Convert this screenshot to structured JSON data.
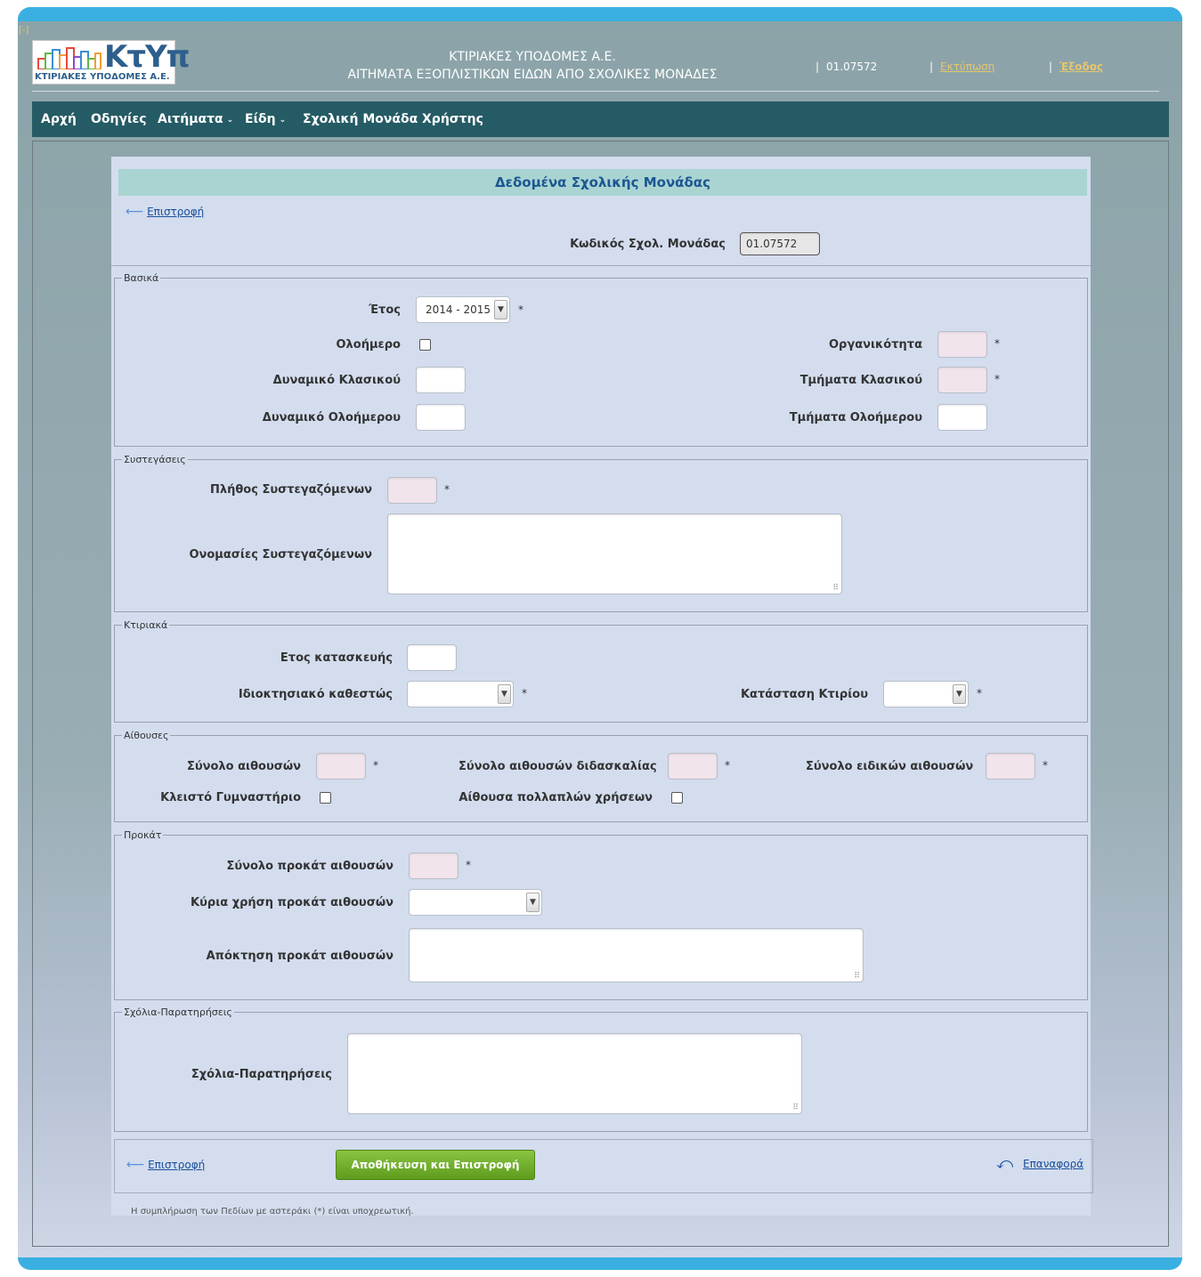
{
  "header": {
    "collapse": "[-]",
    "logo_text": "ΚτΥπ",
    "logo_sub": "ΚΤΙΡΙΑΚΕΣ ΥΠΟΔΟΜΕΣ Α.Ε.",
    "title_line1": "ΚΤΙΡΙΑΚΕΣ ΥΠΟΔΟΜΕΣ Α.Ε.",
    "title_line2": "ΑΙΤΗΜΑΤΑ ΕΞΟΠΛΙΣΤΙΚΩΝ ΕΙΔΩΝ ΑΠΟ ΣΧΟΛΙΚΕΣ ΜΟΝΑΔΕΣ",
    "sep": "|",
    "school_code": "01.07572",
    "print_label": "Εκτύπωση",
    "logout_label": "Έξοδος"
  },
  "nav": {
    "items": [
      "Αρχή",
      "Οδηγίες",
      "Αιτήματα",
      "Είδη",
      "Σχολική Μονάδα",
      "Χρήστης"
    ],
    "dropdown_caret": "⌄"
  },
  "panel": {
    "title": "Δεδομένα Σχολικής Μονάδας",
    "back_label": "Επιστροφή",
    "code_label": "Κωδικός Σχολ. Μονάδας",
    "code_value": "01.07572"
  },
  "basic": {
    "legend": "Βασικά",
    "year_label": "Έτος",
    "year_value": "2014 - 2015",
    "allday_label": "Ολοήμερο",
    "organic_label": "Οργανικότητα",
    "dyn_classic_label": "Δυναμικό Κλασικού",
    "sections_classic_label": "Τμήματα Κλασικού",
    "dyn_allday_label": "Δυναμικό Ολοήμερου",
    "sections_allday_label": "Τμήματα Ολοήμερου"
  },
  "cohoused": {
    "legend": "Συστεγάσεις",
    "count_label": "Πλήθος Συστεγαζόμενων",
    "names_label": "Ονομασίες Συστεγαζόμενων"
  },
  "building": {
    "legend": "Κτιριακά",
    "year_built_label": "Ετος κατασκευής",
    "ownership_label": "Ιδιοκτησιακό καθεστώς",
    "condition_label": "Κατάσταση Κτιρίου"
  },
  "rooms": {
    "legend": "Αίθουσες",
    "total_label": "Σύνολο αιθουσών",
    "teaching_label": "Σύνολο αιθουσών διδασκαλίας",
    "special_label": "Σύνολο ειδικών αιθουσών",
    "gym_label": "Κλειστό Γυμναστήριο",
    "multi_label": "Αίθουσα πολλαπλών χρήσεων"
  },
  "prefab": {
    "legend": "Προκάτ",
    "total_label": "Σύνολο προκάτ αιθουσών",
    "use_label": "Κύρια χρήση προκάτ αιθουσών",
    "acquire_label": "Απόκτηση προκάτ αιθουσών"
  },
  "comments": {
    "legend": "Σχόλια-Παρατηρήσεις",
    "label": "Σχόλια-Παρατηρήσεις"
  },
  "footer": {
    "back_label": "Επιστροφή",
    "save_label": "Αποθήκευση και Επιστροφή",
    "reset_label": "Επαναφορά",
    "note": "Η συμπλήρωση των Πεδίων με αστεράκι (*) είναι υποχρεωτική."
  },
  "required_mark": "*",
  "colors": {
    "accent_blue": "#3ab0e2",
    "nav_bg": "#255b65",
    "panel_bg": "#d3ddee",
    "title_bg": "#aad4d2",
    "required_input_bg": "#f2e4ec",
    "save_button": "#6fae2c"
  }
}
